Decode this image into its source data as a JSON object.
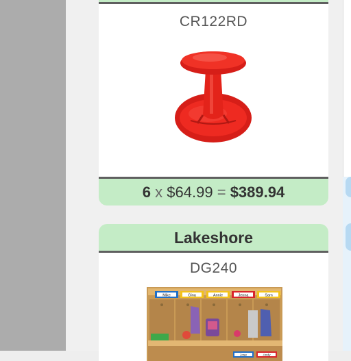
{
  "products": [
    {
      "brand": "",
      "sku": "CR122RD",
      "image_icon": "red-wobble-stool-icon",
      "quantity": "6",
      "times_symbol": "x",
      "unit_price": "$64.99",
      "equals_symbol": "=",
      "total": "$389.94"
    },
    {
      "brand": "Lakeshore",
      "sku": "DG240",
      "image_icon": "wooden-cubby-coat-locker-icon",
      "cubby_name_labels": [
        "Mike",
        "Gina",
        "Annie",
        "Jenna",
        "Sam"
      ],
      "lower_name_labels": [
        "Jose",
        "Andy"
      ]
    }
  ],
  "colors": {
    "header_green": "#c4ecc6",
    "divider_gray": "#5f5f5f",
    "stool_red": "#e8231b",
    "gutter_gray": "#acacac"
  }
}
